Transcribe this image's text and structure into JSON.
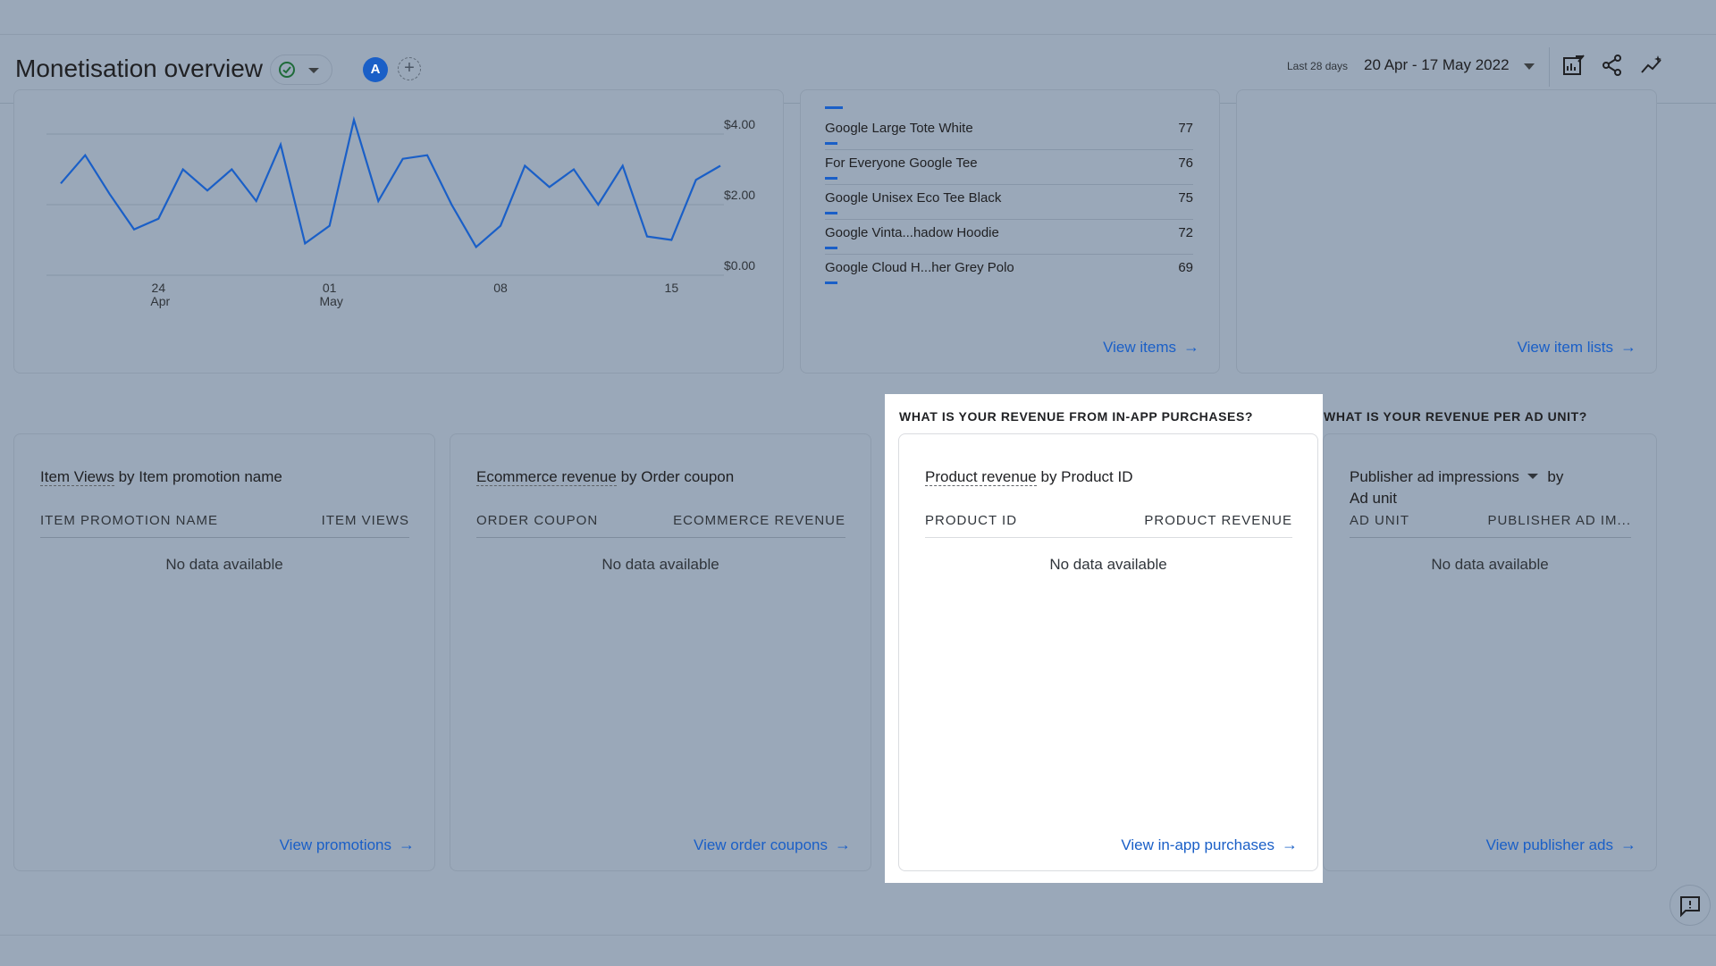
{
  "header": {
    "title": "Monetisation overview",
    "avatar_letter": "A",
    "add_comparison": "+",
    "date_label": "Last 28 days",
    "date_range": "20 Apr - 17 May 2022"
  },
  "line_chart": {
    "y_ticks": [
      "$4.00",
      "$2.00",
      "$0.00"
    ],
    "x_ticks": [
      {
        "day": "24",
        "month": "Apr"
      },
      {
        "day": "01",
        "month": "May"
      },
      {
        "day": "08",
        "month": ""
      },
      {
        "day": "15",
        "month": ""
      }
    ]
  },
  "chart_data": {
    "type": "line",
    "x": [
      "2022-04-20",
      "2022-04-21",
      "2022-04-22",
      "2022-04-23",
      "2022-04-24",
      "2022-04-25",
      "2022-04-26",
      "2022-04-27",
      "2022-04-28",
      "2022-04-29",
      "2022-04-30",
      "2022-05-01",
      "2022-05-02",
      "2022-05-03",
      "2022-05-04",
      "2022-05-05",
      "2022-05-06",
      "2022-05-07",
      "2022-05-08",
      "2022-05-09",
      "2022-05-10",
      "2022-05-11",
      "2022-05-12",
      "2022-05-13",
      "2022-05-14",
      "2022-05-15",
      "2022-05-16",
      "2022-05-17"
    ],
    "series": [
      {
        "values": [
          2.6,
          3.4,
          2.3,
          1.3,
          1.6,
          3.0,
          2.4,
          3.0,
          2.1,
          3.7,
          0.9,
          1.4,
          4.4,
          2.1,
          3.3,
          3.4,
          2.0,
          0.8,
          1.4,
          3.1,
          2.5,
          3.0,
          2.0,
          3.1,
          1.1,
          1.0,
          2.7,
          3.1
        ]
      }
    ],
    "ylim": [
      0,
      4.5
    ],
    "yticks": [
      "$0.00",
      "$2.00",
      "$4.00"
    ],
    "xticks": [
      "24 Apr",
      "01 May",
      "08",
      "15"
    ],
    "grid": true,
    "color": "#1a5fc7"
  },
  "items_card": {
    "rows": [
      {
        "name": "Google Large Tote White",
        "value": "77",
        "fraction": 0.04
      },
      {
        "name": "For Everyone Google Tee",
        "value": "76",
        "fraction": 0.04
      },
      {
        "name": "Google Unisex Eco Tee Black",
        "value": "75",
        "fraction": 0.04
      },
      {
        "name": "Google Vinta...hadow Hoodie",
        "value": "72",
        "fraction": 0.04
      },
      {
        "name": "Google Cloud H...her Grey Polo",
        "value": "69",
        "fraction": 0.04
      }
    ],
    "link": "View items"
  },
  "item_lists_card": {
    "link": "View item lists"
  },
  "questions": {
    "in_app": "WHAT IS YOUR REVENUE FROM IN-APP PURCHASES?",
    "ad_unit": "WHAT IS YOUR REVENUE PER AD UNIT?"
  },
  "promo_card": {
    "metric": "Item Views",
    "dimension": "by Item promotion name",
    "col1": "ITEM PROMOTION NAME",
    "col2": "ITEM VIEWS",
    "empty": "No data available",
    "link": "View promotions"
  },
  "coupon_card": {
    "metric": "Ecommerce revenue",
    "dimension": "by Order coupon",
    "col1": "ORDER COUPON",
    "col2": "ECOMMERCE REVENUE",
    "empty": "No data available",
    "link": "View order coupons"
  },
  "iap_card": {
    "metric": "Product revenue",
    "dimension": "by Product ID",
    "col1": "PRODUCT ID",
    "col2": "PRODUCT REVENUE",
    "empty": "No data available",
    "link": "View in-app purchases"
  },
  "ads_card": {
    "metric": "Publisher ad impressions",
    "by": "by",
    "dimension": "Ad unit",
    "col1": "AD UNIT",
    "col2": "PUBLISHER AD IM...",
    "empty": "No data available",
    "link": "View publisher ads"
  },
  "colors": {
    "accent": "#1a5fc7",
    "overlay": "#9aa8b9",
    "success": "#188038"
  },
  "icons": [
    "check-circle-icon",
    "customize-report-icon",
    "share-icon",
    "insights-icon",
    "feedback-icon",
    "arrow-right-icon"
  ]
}
